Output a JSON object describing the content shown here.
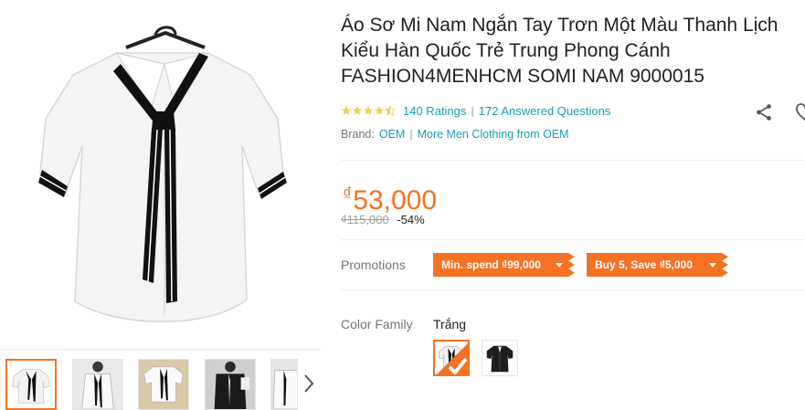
{
  "product": {
    "title": "Áo Sơ Mi Nam Ngắn Tay Trơn Một Màu Thanh Lịch Kiểu Hàn Quốc Trẻ Trung Phong Cánh FASHION4MENHCM SOMI NAM 9000015",
    "rating_stars": 4.5,
    "ratings_text": "140 Ratings",
    "questions_text": "172 Answered Questions",
    "brand_label": "Brand:",
    "brand_name": "OEM",
    "more_from_brand": "More Men Clothing from OEM"
  },
  "price": {
    "currency": "₫",
    "current": "53,000",
    "original": "₫115,000",
    "discount": "-54%"
  },
  "promotions": {
    "label": "Promotions",
    "tags": [
      "Min. spend ₫99,000",
      "Buy 5, Save ₫5,000"
    ]
  },
  "variants": {
    "label": "Color Family",
    "selected": "Trắng",
    "options": [
      {
        "name": "white-shirt",
        "color": "#ffffff"
      },
      {
        "name": "black-shirt",
        "color": "#1e1e1e"
      }
    ]
  },
  "gallery": {
    "thumbnails": [
      "white-shirt-tie",
      "white-shirt-model",
      "white-shirt-flat",
      "black-shirt-model",
      "white-shirt-side"
    ]
  },
  "colors": {
    "accent": "#f57224",
    "link": "#1a9cb7",
    "star": "#faca51"
  }
}
